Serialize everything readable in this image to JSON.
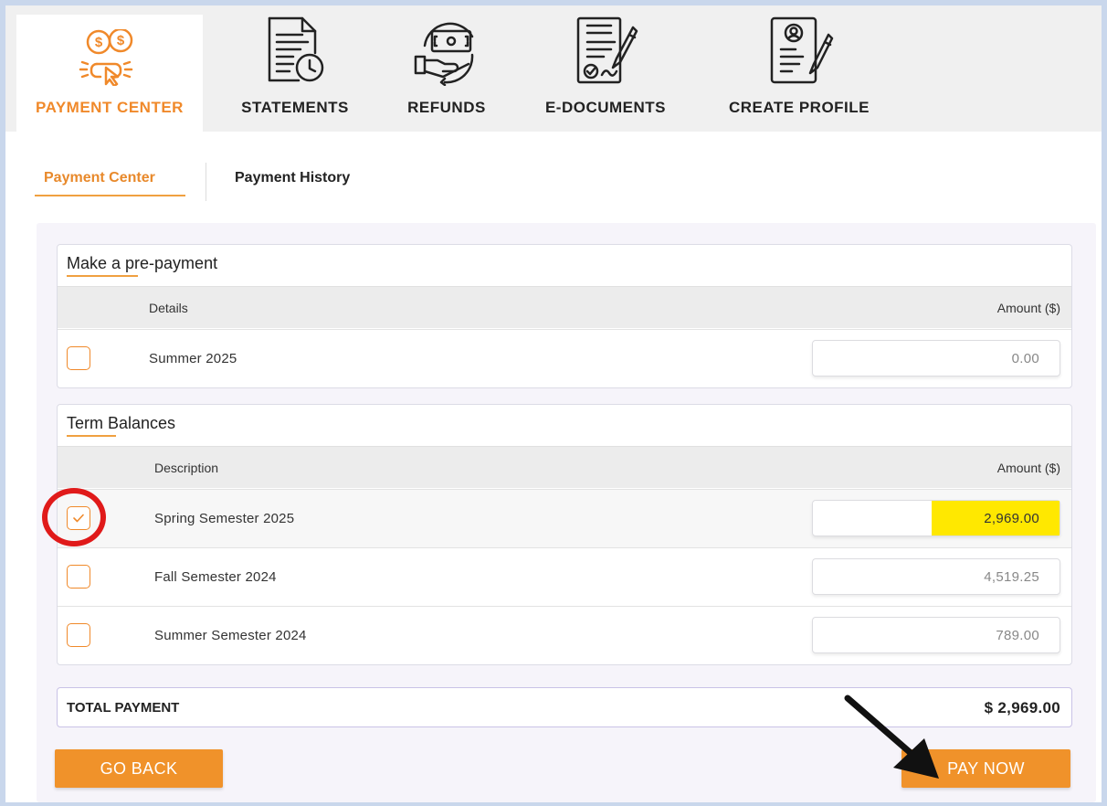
{
  "top_nav": {
    "tabs": [
      {
        "label": "PAYMENT CENTER",
        "icon": "payment-click-icon",
        "active": true
      },
      {
        "label": "STATEMENTS",
        "icon": "statement-clock-icon",
        "active": false
      },
      {
        "label": "REFUNDS",
        "icon": "refund-hand-cash-icon",
        "active": false
      },
      {
        "label": "E-DOCUMENTS",
        "icon": "document-sign-icon",
        "active": false
      },
      {
        "label": "CREATE PROFILE",
        "icon": "profile-edit-icon",
        "active": false
      }
    ]
  },
  "sub_tabs": [
    {
      "label": "Payment Center",
      "active": true
    },
    {
      "label": "Payment History",
      "active": false
    }
  ],
  "prepayment": {
    "title": "Make a pre-payment",
    "header": {
      "details": "Details",
      "amount": "Amount ($)"
    },
    "rows": [
      {
        "label": "Summer 2025",
        "amount": "0.00",
        "checked": false
      }
    ]
  },
  "term_balances": {
    "title": "Term Balances",
    "header": {
      "description": "Description",
      "amount": "Amount ($)"
    },
    "rows": [
      {
        "label": "Spring Semester 2025",
        "amount": "2,969.00",
        "checked": true,
        "highlighted": true
      },
      {
        "label": "Fall Semester 2024",
        "amount": "4,519.25",
        "checked": false
      },
      {
        "label": "Summer Semester 2024",
        "amount": "789.00",
        "checked": false
      }
    ]
  },
  "total": {
    "label": "TOTAL PAYMENT",
    "value": "$ 2,969.00"
  },
  "buttons": {
    "go_back": "GO BACK",
    "pay_now": "PAY NOW"
  },
  "colors": {
    "accent": "#f0892a",
    "button": "#f0922a",
    "highlight": "#ffe800",
    "annotation_red": "#e01a1a",
    "page_bg": "#c9d7ec"
  }
}
